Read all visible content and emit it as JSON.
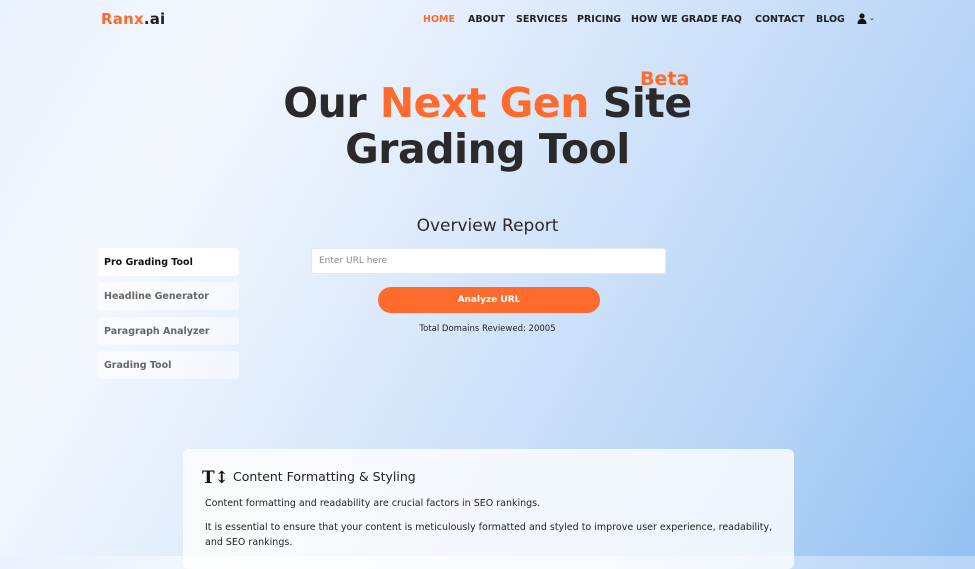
{
  "brand": {
    "part1": "Ranx",
    "part2": ".ai",
    "accent_color": "#ff6b2c"
  },
  "nav": {
    "items": [
      {
        "label": "HOME",
        "active": true
      },
      {
        "label": "ABOUT"
      },
      {
        "label": "SERVICES"
      },
      {
        "label": "PRICING"
      },
      {
        "label": "HOW WE GRADE"
      },
      {
        "label": "FAQ"
      },
      {
        "label": "CONTACT"
      },
      {
        "label": "BLOG"
      }
    ],
    "user_icon": "user-icon",
    "user_chevron": "⌄"
  },
  "hero": {
    "line1_pre": "Our ",
    "line1_accent": "Next Gen",
    "line1_post": " Site",
    "line2": "Grading Tool",
    "badge": "Beta"
  },
  "report": {
    "title": "Overview Report",
    "input_placeholder": "Enter URL here",
    "input_value": "",
    "button_label": "Analyze URL",
    "total_label": "Total Domains Reviewed: 20005"
  },
  "sidebar": {
    "items": [
      {
        "label": "Pro Grading Tool",
        "active": true
      },
      {
        "label": "Headline Generator"
      },
      {
        "label": "Paragraph Analyzer"
      },
      {
        "label": "Grading Tool"
      }
    ]
  },
  "card": {
    "icon": "text-size-icon",
    "icon_glyph": "T↕",
    "title": "Content Formatting & Styling",
    "paragraphs": [
      "Content formatting and readability are crucial factors in SEO rankings.",
      "It is essential to ensure that your content is meticulously formatted and styled to improve user experience, readability, and SEO rankings."
    ]
  }
}
